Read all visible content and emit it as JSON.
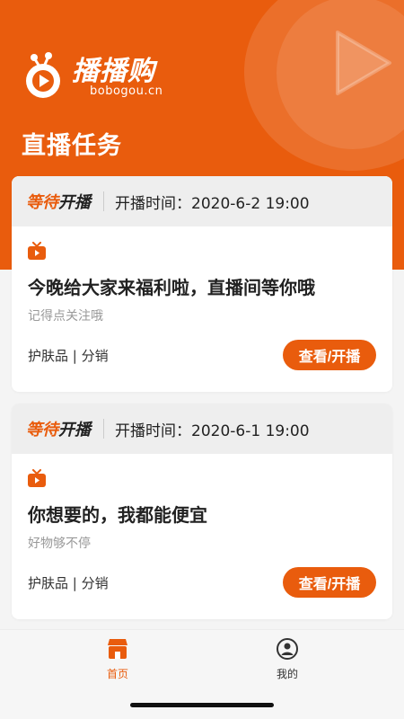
{
  "brand": {
    "name": "播播购",
    "domain": "bobogou.cn",
    "color": "#e95c0d"
  },
  "page_title": "直播任务",
  "cards": [
    {
      "status_part1": "等待",
      "status_part2": "开播",
      "start_time": "开播时间：2020-6-2 19:00",
      "icon": "tv-icon",
      "title": "今晚给大家来福利啦，直播间等你哦",
      "subtitle": "记得点关注哦",
      "tags": "护肤品 | 分销",
      "button": "查看/开播"
    },
    {
      "status_part1": "等待",
      "status_part2": "开播",
      "start_time": "开播时间：2020-6-1 19:00",
      "icon": "tv-icon",
      "title": "你想要的，我都能便宜",
      "subtitle": "好物够不停",
      "tags": "护肤品 | 分销",
      "button": "查看/开播"
    }
  ],
  "tabbar": {
    "home": {
      "label": "首页",
      "icon": "store-icon",
      "active": true
    },
    "mine": {
      "label": "我的",
      "icon": "user-icon",
      "active": false
    }
  }
}
